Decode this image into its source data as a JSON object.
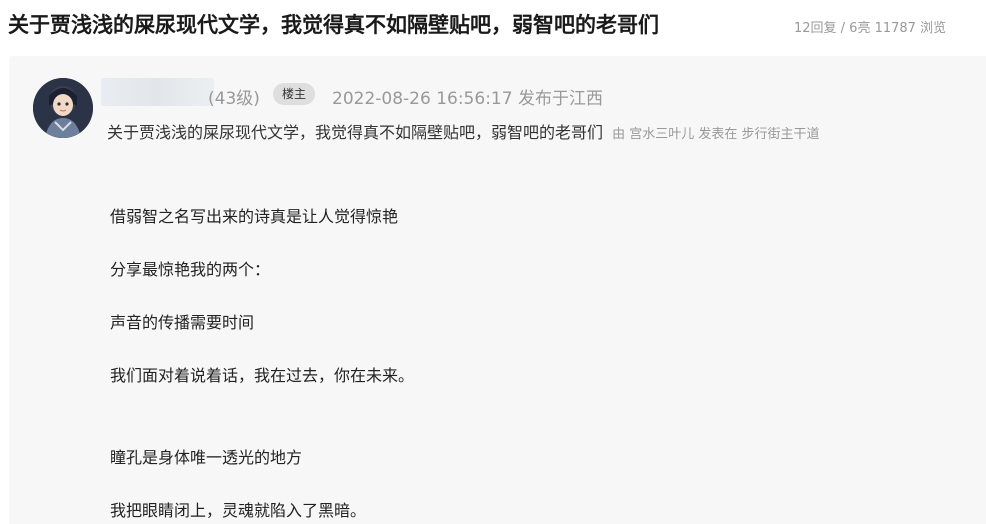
{
  "topic": {
    "title": "关于贾浅浅的屎尿现代文学，我觉得真不如隔壁贴吧，弱智吧的老哥们",
    "stats": "12回复 / 6亮 11787 浏览"
  },
  "post": {
    "user_level": "(43级)",
    "badge": "楼主",
    "meta": "2022-08-26 16:56:17 发布于江西",
    "quote_title": "关于贾浅浅的屎尿现代文学，我觉得真不如隔壁贴吧，弱智吧的老哥们",
    "quote_from": "由 宫水三叶儿 发表在 步行街主干道",
    "body": [
      "借弱智之名写出来的诗真是让人觉得惊艳",
      "分享最惊艳我的两个：",
      "声音的传播需要时间",
      "我们面对着说着话，我在过去，你在未来。",
      "瞳孔是身体唯一透光的地方",
      "我把眼睛闭上，灵魂就陷入了黑暗。"
    ]
  }
}
